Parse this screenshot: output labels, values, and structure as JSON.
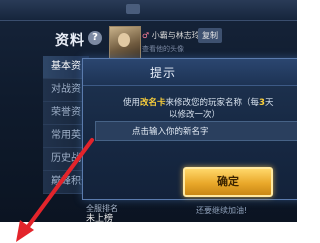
{
  "header": {
    "title": "资料",
    "help_label": "?",
    "player_name_prefix": "小霸与林志玲",
    "copy_label": "复制",
    "sub_text": "查看他的头像"
  },
  "sidebar": {
    "items": [
      {
        "label": "基本资"
      },
      {
        "label": "对战资"
      },
      {
        "label": "荣誉资"
      },
      {
        "label": "常用英"
      },
      {
        "label": "历史战"
      },
      {
        "label": "巅峰积分"
      }
    ]
  },
  "dialog": {
    "title": "提示",
    "msg_prefix": "使用",
    "msg_item": "改名卡",
    "msg_middle": "来修改您的玩家名称（每",
    "msg_days": "3",
    "msg_suffix": "天",
    "msg_line2": "以修改一次）",
    "input_placeholder": "点击输入你的新名字",
    "confirm_label": "确定"
  },
  "footer": {
    "rank_label": "全服排名",
    "rank_value": "未上榜",
    "right_text": "还要继续加油!"
  },
  "colors": {
    "highlight": "#ffd23a",
    "button": "#e9a82a",
    "arrow": "#e3242b"
  }
}
